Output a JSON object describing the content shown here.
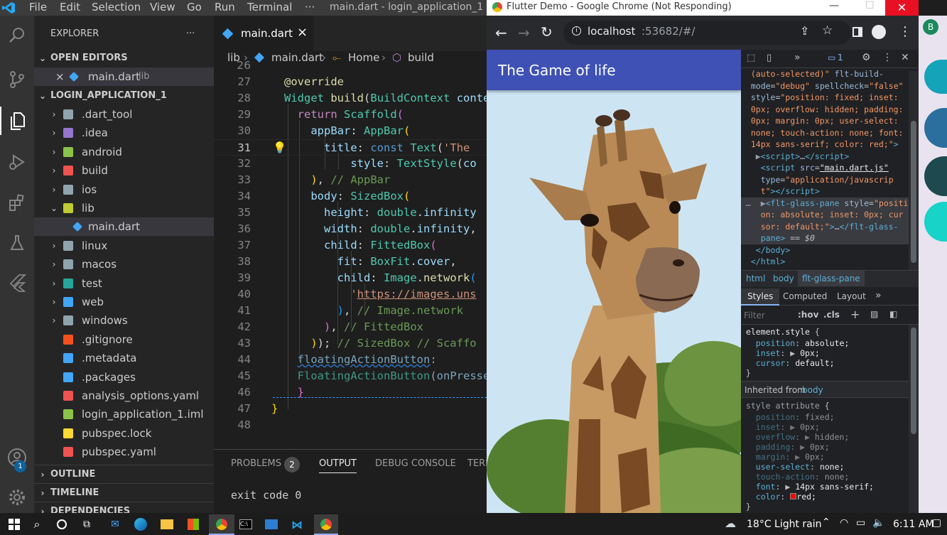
{
  "vscode": {
    "menu": [
      "File",
      "Edit",
      "Selection",
      "View",
      "Go",
      "Run",
      "Terminal"
    ],
    "more": "···",
    "window_title": "main.dart - login_application_1 - Vi",
    "explorer_title": "EXPLORER",
    "explorer_more": "···",
    "open_editors_header": "OPEN EDITORS",
    "open_editor_file": "main.dart",
    "open_editor_folder": "lib",
    "project_header": "LOGIN_APPLICATION_1",
    "tree": [
      {
        "name": ".dart_tool",
        "icon": "folder-icon",
        "color": "#90a4ae",
        "type": "folder"
      },
      {
        "name": ".idea",
        "icon": "idea-folder-icon",
        "color": "#9575cd",
        "type": "folder"
      },
      {
        "name": "android",
        "icon": "android-folder-icon",
        "color": "#8bc34a",
        "type": "folder"
      },
      {
        "name": "build",
        "icon": "build-folder-icon",
        "color": "#ef5350",
        "type": "folder"
      },
      {
        "name": "ios",
        "icon": "ios-folder-icon",
        "color": "#90a4ae",
        "type": "folder"
      },
      {
        "name": "lib",
        "icon": "lib-folder-open-icon",
        "color": "#c0ca33",
        "type": "folder-open"
      },
      {
        "name": "main.dart",
        "icon": "dart-file-icon",
        "color": "#42a5f5",
        "type": "file",
        "indent": 1
      },
      {
        "name": "linux",
        "icon": "folder-icon",
        "color": "#90a4ae",
        "type": "folder"
      },
      {
        "name": "macos",
        "icon": "folder-icon",
        "color": "#90a4ae",
        "type": "folder"
      },
      {
        "name": "test",
        "icon": "test-folder-icon",
        "color": "#26a69a",
        "type": "folder"
      },
      {
        "name": "web",
        "icon": "web-folder-icon",
        "color": "#42a5f5",
        "type": "folder"
      },
      {
        "name": "windows",
        "icon": "folder-icon",
        "color": "#90a4ae",
        "type": "folder"
      },
      {
        "name": ".gitignore",
        "icon": "git-file-icon",
        "color": "#f4511e",
        "type": "file"
      },
      {
        "name": ".metadata",
        "icon": "file-icon",
        "color": "#42a5f5",
        "type": "file"
      },
      {
        "name": ".packages",
        "icon": "file-icon",
        "color": "#42a5f5",
        "type": "file"
      },
      {
        "name": "analysis_options.yaml",
        "icon": "yaml-file-icon",
        "color": "#ef5350",
        "type": "file"
      },
      {
        "name": "login_application_1.iml",
        "icon": "iml-file-icon",
        "color": "#8bc34a",
        "type": "file"
      },
      {
        "name": "pubspec.lock",
        "icon": "lock-file-icon",
        "color": "#fdd835",
        "type": "file"
      },
      {
        "name": "pubspec.yaml",
        "icon": "yaml-file-icon",
        "color": "#ef5350",
        "type": "file"
      }
    ],
    "outline_header": "OUTLINE",
    "timeline_header": "TIMELINE",
    "dependencies_header": "DEPENDENCIES",
    "account_badge": "1",
    "tab_label": "main.dart",
    "tab_close": "×",
    "breadcrumb": [
      "lib",
      "main.dart",
      "Home",
      "build"
    ],
    "line_numbers": [
      "26",
      "27",
      "28",
      "29",
      "30",
      "31",
      "32",
      "33",
      "34",
      "35",
      "36",
      "37",
      "38",
      "39",
      "40",
      "41",
      "42",
      "43",
      "44",
      "45",
      "46",
      "47",
      "48"
    ],
    "current_line": "31",
    "panel_tabs": [
      "PROBLEMS",
      "OUTPUT",
      "DEBUG CONSOLE",
      "TERM"
    ],
    "problems_count": "2",
    "output_text": "exit code 0"
  },
  "chrome": {
    "window_title": "Flutter Demo - Google Chrome (Not Responding)",
    "url_host": "localhost",
    "url_rest": ":53682/#/",
    "profile_letter": "B",
    "app_title": "The Game of life",
    "devtools": {
      "issues_count": "1",
      "crumbs": [
        "html",
        "body",
        "flt-glass-pane"
      ],
      "tabs": [
        "Styles",
        "Computed",
        "Layout"
      ],
      "filter_placeholder": "Filter",
      "hov": ":hov",
      "cls": ".cls",
      "inherited_label": "Inherited from",
      "inherited_from": "body"
    }
  },
  "taskbar": {
    "weather": "18°C  Light rain",
    "time": "6:11 AM"
  }
}
